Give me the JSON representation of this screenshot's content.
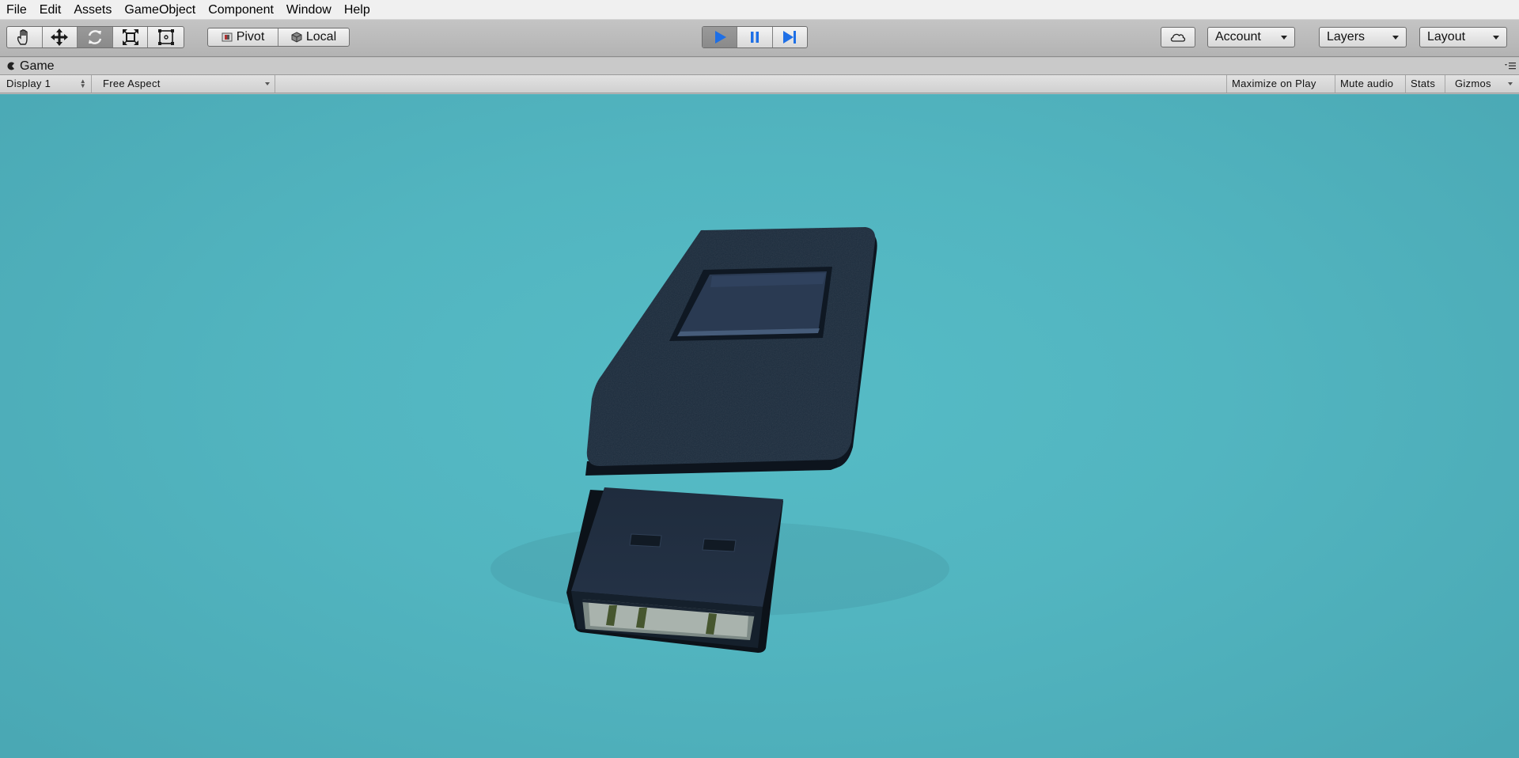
{
  "menu": [
    "File",
    "Edit",
    "Assets",
    "GameObject",
    "Component",
    "Window",
    "Help"
  ],
  "toolbar": {
    "transform_tools": [
      {
        "name": "hand-tool",
        "icon": "hand-icon",
        "active": false
      },
      {
        "name": "move-tool",
        "icon": "move-arrows-icon",
        "active": false
      },
      {
        "name": "rotate-tool",
        "icon": "rotate-icon",
        "active": true
      },
      {
        "name": "scale-tool",
        "icon": "scale-icon",
        "active": false
      },
      {
        "name": "rect-tool",
        "icon": "rect-transform-icon",
        "active": false
      }
    ],
    "pivot_label": "Pivot",
    "local_label": "Local",
    "playback": {
      "play_icon": "play-icon",
      "pause_icon": "pause-icon",
      "step_icon": "step-icon",
      "play_active": true,
      "accent": "#1e6fe6"
    },
    "cloud_icon": "cloud-icon",
    "account_label": "Account",
    "layers_label": "Layers",
    "layout_label": "Layout"
  },
  "game_window": {
    "tab_title": "Game",
    "display": "Display 1",
    "aspect": "Free Aspect",
    "maximize_on_play": "Maximize on Play",
    "mute_audio": "Mute audio",
    "stats": "Stats",
    "gizmos": "Gizmos"
  },
  "scene": {
    "background_color": "#52b7c2",
    "object": "usb-flash-drive-model",
    "body_color": "#1c2c3c",
    "plug_color": "#202d40"
  }
}
